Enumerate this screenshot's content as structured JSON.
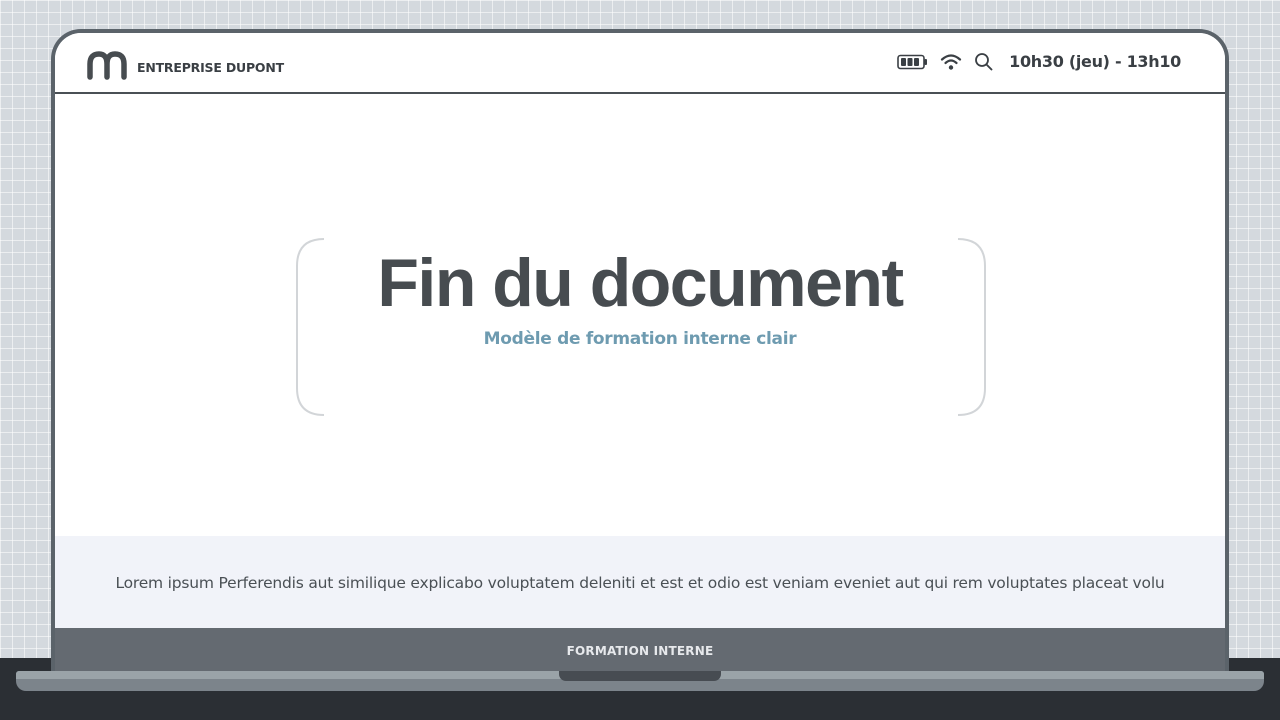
{
  "brand": {
    "name": "ENTREPRISE DUPONT",
    "logo_icon": "m-logo-icon"
  },
  "status_bar": {
    "battery_icon": "battery-icon",
    "wifi_icon": "wifi-icon",
    "search_icon": "search-icon",
    "time": "10h30 (jeu) - 13h10"
  },
  "hero": {
    "title": "Fin du document",
    "subtitle": "Modèle de formation interne clair"
  },
  "band": {
    "text": "Lorem ipsum Perferendis aut similique explicabo voluptatem deleniti et est et odio est veniam eveniet aut qui rem voluptates placeat volu"
  },
  "footer": {
    "label": "FORMATION INTERNE"
  },
  "colors": {
    "title": "#474c50",
    "subtitle": "#6e9bb0",
    "footer_bg": "#646a71",
    "band_bg": "#f1f3f9"
  }
}
